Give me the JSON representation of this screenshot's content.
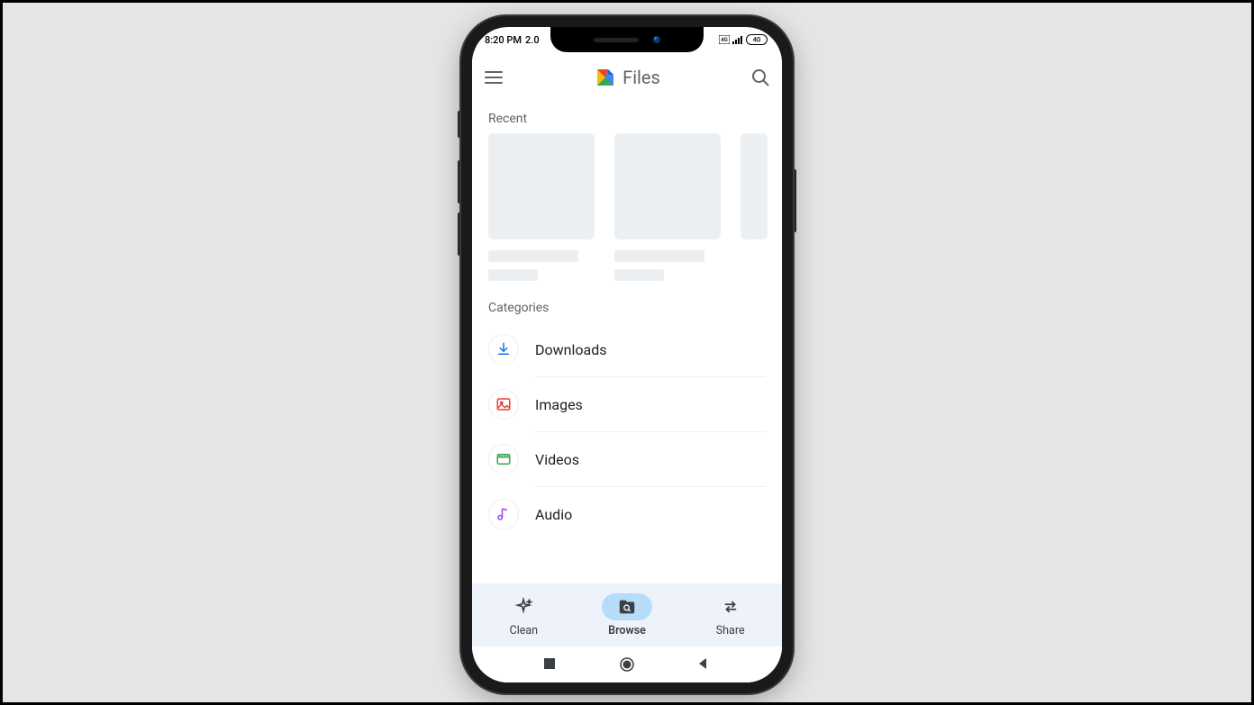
{
  "status_bar": {
    "time": "8:20 PM",
    "extra": "2.0",
    "battery": "40"
  },
  "header": {
    "title": "Files"
  },
  "sections": {
    "recent_label": "Recent",
    "categories_label": "Categories"
  },
  "categories": [
    {
      "label": "Downloads",
      "icon": "download-icon",
      "color": "#1a73e8"
    },
    {
      "label": "Images",
      "icon": "images-icon",
      "color": "#ea4335"
    },
    {
      "label": "Videos",
      "icon": "videos-icon",
      "color": "#34a853"
    },
    {
      "label": "Audio",
      "icon": "audio-icon",
      "color": "#a142f4"
    }
  ],
  "bottom_nav": {
    "clean": "Clean",
    "browse": "Browse",
    "share": "Share"
  }
}
